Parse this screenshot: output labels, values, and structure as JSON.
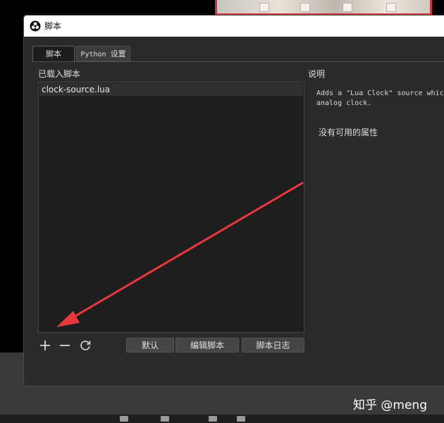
{
  "window": {
    "title": "脚本"
  },
  "tabs": [
    {
      "label": "脚本"
    },
    {
      "label_prefix": "Python",
      "label_suffix": "设置"
    }
  ],
  "loaded_scripts": {
    "label": "已载入脚本",
    "items": [
      "clock-source.lua"
    ]
  },
  "description": {
    "label": "说明",
    "text": "Adds a \"Lua Clock\" source whic\nanalog clock.",
    "no_properties": "没有可用的属性"
  },
  "buttons": {
    "defaults": "默认",
    "edit_script": "编辑脚本",
    "script_log": "脚本日志"
  },
  "watermark": "知乎 @meng",
  "colors": {
    "arrow": "#e8383d",
    "window_bg": "#2b2b2b",
    "list_bg": "#1e1e1e"
  }
}
